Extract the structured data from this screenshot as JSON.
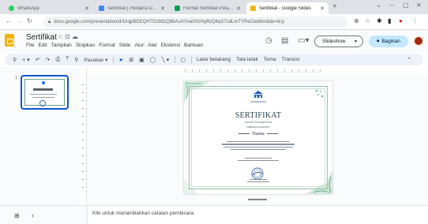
{
  "browser": {
    "tabs": [
      {
        "title": "WhatsApp",
        "favicon_color": "#25d366"
      },
      {
        "title": "Sertifikat | Perdana Digital - Lin...",
        "favicon_color": "#4285f4"
      },
      {
        "title": "Format Sertifikat Pelatihan - Digi...",
        "favicon_color": "#0f9d58"
      },
      {
        "title": "Sertifikat - Google Slides",
        "favicon_color": "#f4b400"
      }
    ],
    "url": "docs.google.com/presentation/d/1hqpBDEQH7Gzb9zQ8bAuXVvaV0zHyBzQ4qS7sdLmTYRe2/edit#slide=id.p"
  },
  "app": {
    "title": "Sertifikat",
    "menu": [
      "File",
      "Edit",
      "Tampilan",
      "Sisipkan",
      "Format",
      "Slide",
      "Atur",
      "Alat",
      "Ekstensi",
      "Bantuan"
    ],
    "slideshow_label": "Slideshow",
    "share_label": "Bagikan"
  },
  "toolbar": {
    "zoom_label": "Passkan",
    "background_label": "Latar belakang",
    "layout_label": "Tata letak",
    "theme_label": "Tema",
    "transition_label": "Transisi"
  },
  "filmstrip": {
    "slide_number": "1"
  },
  "slide": {
    "institution": "UNIVERSITAS",
    "title": "SERTIFIKAT",
    "subtitle": "NOMOR: 001/SERT/2023",
    "given_to": "DIBERIKAN KEPADA",
    "name": "Nama"
  },
  "notes": {
    "placeholder": "Klik untuk menambahkan catatan pembicara"
  },
  "colors": {
    "accent": "#0b57d0",
    "share_bg": "#c2e7ff",
    "logo": "#f4b400",
    "frame": "#8fbfa8"
  }
}
